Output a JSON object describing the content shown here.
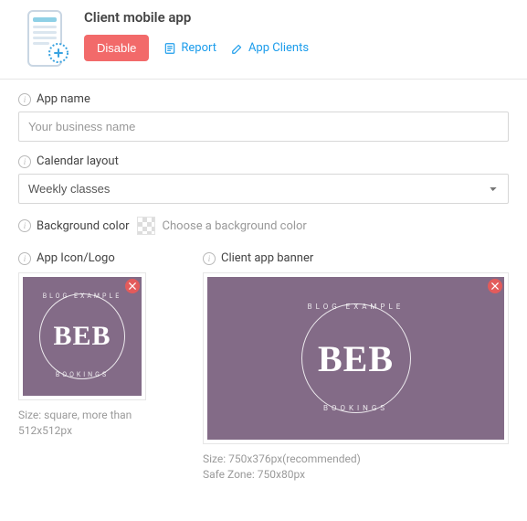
{
  "header": {
    "title": "Client mobile app",
    "disable_label": "Disable",
    "report_label": "Report",
    "app_clients_label": "App Clients"
  },
  "fields": {
    "app_name": {
      "label": "App name",
      "placeholder": "Your business name",
      "value": ""
    },
    "calendar_layout": {
      "label": "Calendar layout",
      "value": "Weekly classes"
    },
    "background_color": {
      "label": "Background color",
      "choose_text": "Choose a background color"
    },
    "app_icon": {
      "label": "App Icon/Logo",
      "caption": "Size: square, more than 512x512px"
    },
    "banner": {
      "label": "Client app banner",
      "caption_line1": "Size: 750x376px(recommended)",
      "caption_line2": "Safe Zone: 750x80px"
    }
  },
  "preview_brand": {
    "top_text": "BLOG EXAMPLE",
    "center_text": "BEB",
    "bottom_text": "BOOKINGS",
    "bg_color": "#836b87"
  }
}
